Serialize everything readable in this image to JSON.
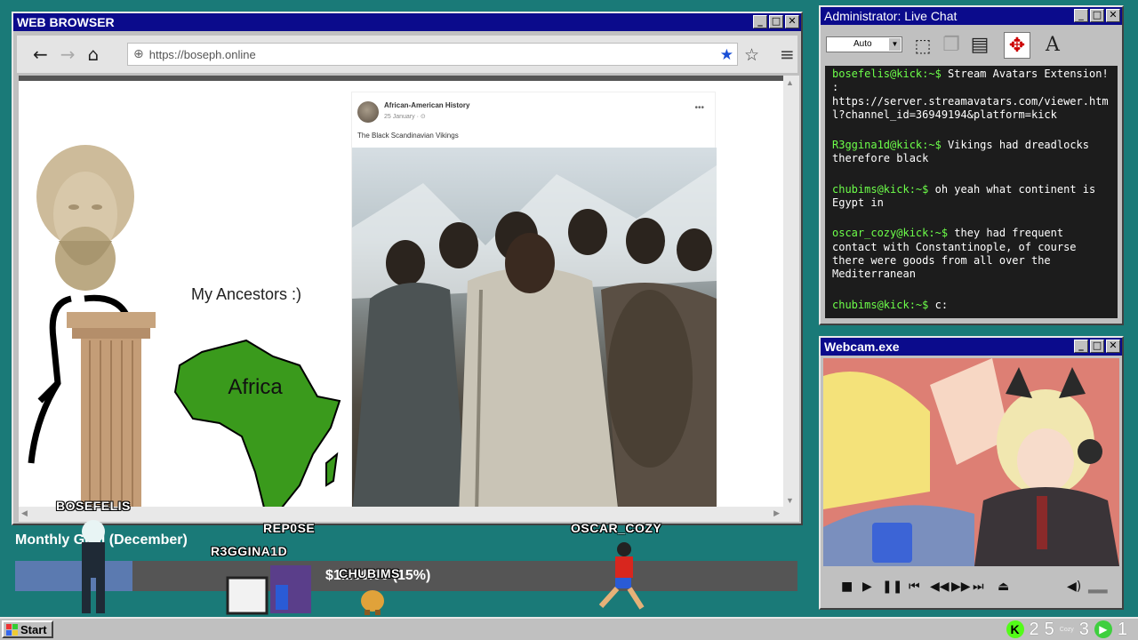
{
  "browser": {
    "title": "WEB BROWSER",
    "url": "https://boseph.online",
    "window_buttons": [
      "_",
      "□",
      "✕"
    ],
    "icons": {
      "back": "←",
      "forward": "→",
      "home": "⌂",
      "globe": "⊕",
      "bookmark_filled": "★",
      "bookmark_outline": "☆",
      "menu": "≡"
    }
  },
  "page": {
    "ancestors_text": "My Ancestors :)",
    "africa_label": "Africa",
    "post": {
      "author": "African-American History",
      "date": "25 January · ⊙",
      "caption": "The Black Scandinavian Vikings",
      "more": "•••"
    }
  },
  "overlay": {
    "names": [
      "BOSEFELIS",
      "REP0SE",
      "R3GGINA1D",
      "CHUBIMS",
      "OSCAR_COZY"
    ],
    "goal_label": "Monthly Goal (December)",
    "goal_amount": "$1...00.00 (15%)",
    "goal_percent": 15
  },
  "chat": {
    "title": "Administrator: Live Chat",
    "select_value": "Auto",
    "messages": [
      {
        "user": "bosefelis@kick:~$",
        "text": " Stream Avatars Extension! : https://server.streamavatars.com/viewer.html?channel_id=36949194&platform=kick"
      },
      {
        "user": "R3ggina1d@kick:~$",
        "text": " Vikings had dreadlocks therefore black"
      },
      {
        "user": "chubims@kick:~$",
        "text": " oh yeah what continent is Egypt in"
      },
      {
        "user": "oscar_cozy@kick:~$",
        "text": " they had frequent contact with Constantinople, of course there were goods from all over the Mediterranean"
      },
      {
        "user": "chubims@kick:~$",
        "text": " c:"
      }
    ]
  },
  "webcam": {
    "title": "Webcam.exe"
  },
  "taskbar": {
    "start_label": "Start",
    "tray_numbers": [
      "2",
      "5",
      "3",
      "1"
    ],
    "tray_small": "Cozy"
  },
  "colors": {
    "desktop": "#1a7a78",
    "titlebar": "#0b0b8c",
    "chat_user": "#6dff4a",
    "goal_fill": "#5b7ab0",
    "kick_green": "#53fc18"
  }
}
